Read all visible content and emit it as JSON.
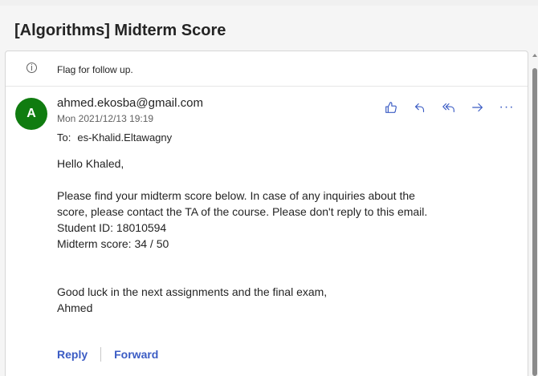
{
  "subject": "[Algorithms] Midterm Score",
  "infobar": {
    "text": "Flag for follow up.",
    "icon": "info-icon"
  },
  "message": {
    "avatar_initial": "A",
    "sender": "ahmed.ekosba@gmail.com",
    "date": "Mon 2021/12/13 19:19",
    "to_label": "To:",
    "to_name": "es-Khalid.Eltawagny",
    "actions": [
      {
        "name": "like",
        "icon": "thumbs-up-icon"
      },
      {
        "name": "reply",
        "icon": "reply-icon"
      },
      {
        "name": "reply-all",
        "icon": "reply-all-icon"
      },
      {
        "name": "forward",
        "icon": "forward-icon"
      },
      {
        "name": "more",
        "icon": "more-icon",
        "label": "···"
      }
    ],
    "body": {
      "greeting": "Hello Khaled,",
      "paragraph": "Please find your midterm score below. In case of any inquiries about the score, please contact the TA of the course. Please don't reply to this email.",
      "student_id": "Student ID: 18010594",
      "score": "Midterm score: 34 / 50",
      "closing_line": "Good luck in the next assignments and the final exam,",
      "signature": "Ahmed"
    }
  },
  "footer": {
    "reply_label": "Reply",
    "forward_label": "Forward"
  },
  "colors": {
    "accent": "#3b5cc4",
    "avatar": "#107c10",
    "text": "#242424",
    "muted": "#616161"
  }
}
